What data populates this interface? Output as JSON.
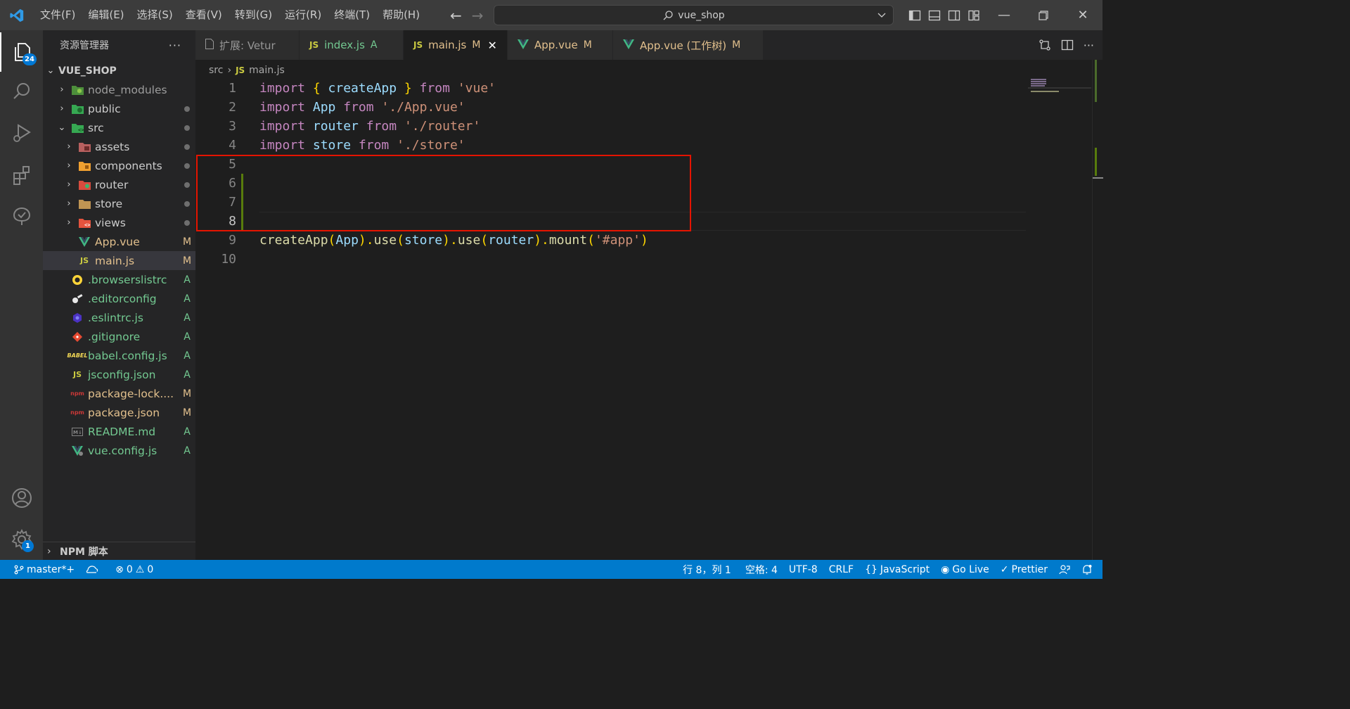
{
  "menu": [
    "文件(F)",
    "编辑(E)",
    "选择(S)",
    "查看(V)",
    "转到(G)",
    "运行(R)",
    "终端(T)",
    "帮助(H)"
  ],
  "command_center": {
    "text": "vue_shop"
  },
  "activity": {
    "explorer_badge": "24",
    "settings_badge": "1"
  },
  "sidebar": {
    "title": "资源管理器",
    "more": "···",
    "project": "VUE_SHOP",
    "npm": "NPM 脚本"
  },
  "tree": [
    {
      "name": "node_modules",
      "status": "",
      "dot": false
    },
    {
      "name": "public",
      "status": "",
      "dot": true
    },
    {
      "name": "src",
      "status": "",
      "dot": true
    },
    {
      "name": "assets",
      "status": "",
      "dot": true
    },
    {
      "name": "components",
      "status": "",
      "dot": true
    },
    {
      "name": "router",
      "status": "",
      "dot": true
    },
    {
      "name": "store",
      "status": "",
      "dot": true
    },
    {
      "name": "views",
      "status": "",
      "dot": true
    },
    {
      "name": "App.vue",
      "status": "M",
      "dot": false
    },
    {
      "name": "main.js",
      "status": "M",
      "dot": false
    },
    {
      "name": ".browserslistrc",
      "status": "A",
      "dot": false
    },
    {
      "name": ".editorconfig",
      "status": "A",
      "dot": false
    },
    {
      "name": ".eslintrc.js",
      "status": "A",
      "dot": false
    },
    {
      "name": ".gitignore",
      "status": "A",
      "dot": false
    },
    {
      "name": "babel.config.js",
      "status": "A",
      "dot": false
    },
    {
      "name": "jsconfig.json",
      "status": "A",
      "dot": false
    },
    {
      "name": "package-lock....",
      "status": "M",
      "dot": false
    },
    {
      "name": "package.json",
      "status": "M",
      "dot": false
    },
    {
      "name": "README.md",
      "status": "A",
      "dot": false
    },
    {
      "name": "vue.config.js",
      "status": "A",
      "dot": false
    }
  ],
  "tabs": [
    {
      "label": "扩展: Vetur",
      "status": ""
    },
    {
      "label": "index.js",
      "status": "A"
    },
    {
      "label": "main.js",
      "status": "M"
    },
    {
      "label": "App.vue",
      "status": "M"
    },
    {
      "label": "App.vue (工作树)",
      "status": "M"
    }
  ],
  "breadcrumb": {
    "folder": "src",
    "file": "main.js"
  },
  "code": {
    "line_numbers": [
      "1",
      "2",
      "3",
      "4",
      "5",
      "6",
      "7",
      "8",
      "9",
      "10"
    ],
    "l1": [
      "import",
      " { ",
      "createApp",
      " } ",
      "from",
      " ",
      "'vue'"
    ],
    "l2": [
      "import",
      " ",
      "App",
      " ",
      "from",
      " ",
      "'./App.vue'"
    ],
    "l3": [
      "import",
      " ",
      "router",
      " ",
      "from",
      " ",
      "'./router'"
    ],
    "l4": [
      "import",
      " ",
      "store",
      " ",
      "from",
      " ",
      "'./store'"
    ],
    "l9": [
      "createApp",
      "(",
      "App",
      ").",
      "use",
      "(",
      "store",
      ").",
      "use",
      "(",
      "router",
      ").",
      "mount",
      "(",
      "'#app'",
      ")"
    ]
  },
  "status": {
    "branch": "master*+",
    "errors": "0",
    "warnings": "0",
    "position": "行 8，列 1",
    "spaces": "空格: 4",
    "encoding": "UTF-8",
    "eol": "CRLF",
    "language": "JavaScript",
    "golive": "Go Live",
    "prettier": "Prettier"
  },
  "colors": {
    "statusbar": "#007acc",
    "highlight_box": "#e51400",
    "gutter_modified": "#587c0c"
  }
}
